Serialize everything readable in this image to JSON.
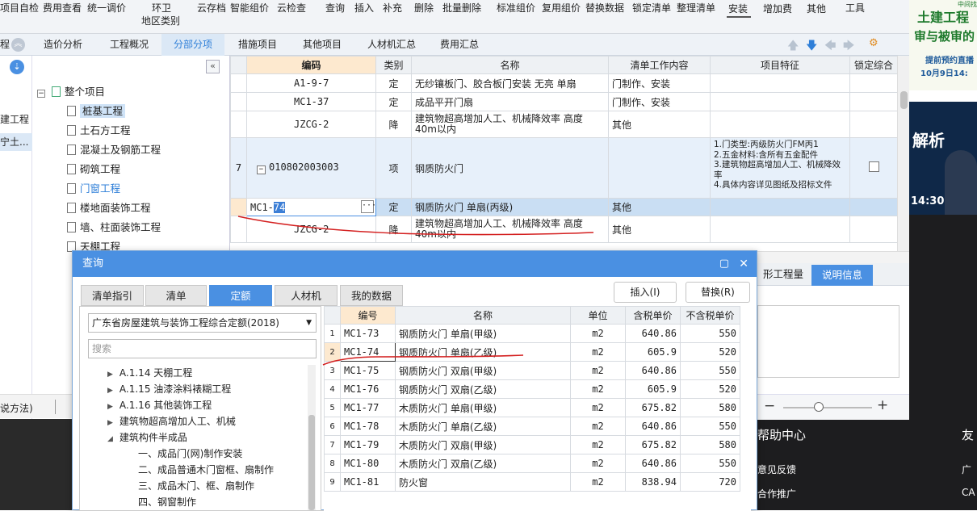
{
  "toolbar": {
    "items": [
      "项目自检",
      "费用查看",
      "统一调价",
      "环卫",
      "地区类别",
      "云存档",
      "智能组价",
      "云检查",
      "查询",
      "插入",
      "补充",
      "删除",
      "批量删除",
      "标准组价",
      "复用组价",
      "替换数据",
      "锁定清单",
      "整理清单",
      "安装",
      "增加费",
      "其他",
      "工具"
    ]
  },
  "ad": {
    "line1": "土建工程",
    "line2": "审与被审的",
    "line3": "提前预约直播",
    "line4": "10月9日14:",
    "tiny": "中间找",
    "mid1": "解析",
    "mid_time": "14:30"
  },
  "nav2": {
    "left_title": "程",
    "tabs": [
      "造价分析",
      "工程概况",
      "分部分项",
      "措施项目",
      "其他项目",
      "人材机汇总",
      "费用汇总"
    ]
  },
  "left_strip": {
    "item1": "建工程",
    "item2": "宁土..."
  },
  "tree": {
    "root": "整个项目",
    "items": [
      "桩基工程",
      "土石方工程",
      "混凝土及钢筋工程",
      "砌筑工程",
      "门窗工程",
      "楼地面装饰工程",
      "墙、柱面装饰工程",
      "天棚工程"
    ]
  },
  "grid": {
    "headers": [
      "编码",
      "类别",
      "名称",
      "清单工作内容",
      "项目特征",
      "锁定综合"
    ],
    "rows": [
      {
        "num": "",
        "code": "A1-9-7",
        "type": "定",
        "name": "无纱镶板门、胶合板门安装 无亮 单扇",
        "work": "门制作、安装",
        "feature": ""
      },
      {
        "num": "",
        "code": "MC1-37",
        "type": "定",
        "name": "成品平开门扇",
        "work": "门制作、安装",
        "feature": ""
      },
      {
        "num": "",
        "code": "JZCG-2",
        "type": "降",
        "name": "建筑物超高增加人工、机械降效率 高度 40m以内",
        "work": "其他",
        "feature": ""
      },
      {
        "num": "7",
        "code": "010802003003",
        "type": "项",
        "name": "钢质防火门",
        "work": "",
        "feature": "1.门类型:丙级防火门FM丙1\n2.五金材料:含所有五金配件\n3.建筑物超高增加人工、机械降效率\n4.具体内容详见图纸及招标文件"
      },
      {
        "num": "",
        "code_prefix": "MC1-",
        "code_sel": "74",
        "type": "定",
        "name": "钢质防火门 单扇(丙级)",
        "work": "其他",
        "feature": ""
      },
      {
        "num": "",
        "code": "JZCG-2",
        "type": "降",
        "name": "建筑物超高增加人工、机械降效率 高度 40m以内",
        "work": "其他",
        "feature": ""
      }
    ]
  },
  "dialog": {
    "title": "查询",
    "tabs": [
      "清单指引",
      "清单",
      "定额",
      "人材机",
      "我的数据"
    ],
    "insert_btn": "插入(I)",
    "replace_btn": "替换(R)",
    "library": "广东省房屋建筑与装饰工程综合定额(2018)",
    "search_placeholder": "搜索",
    "side_items": [
      "A.1.14 天棚工程",
      "A.1.15 油漆涂料裱糊工程",
      "A.1.16 其他装饰工程",
      "建筑物超高增加人工、机械",
      "建筑构件半成品",
      "一、成品门(网)制作安装",
      "二、成品普通木门窗框、扇制作",
      "三、成品木门、框、扇制作",
      "四、钢窗制作"
    ],
    "table_headers": [
      "编号",
      "名称",
      "单位",
      "含税单价",
      "不含税单价"
    ],
    "table_rows": [
      {
        "n": "1",
        "code": "MC1-73",
        "name": "钢质防火门 单扇(甲级)",
        "unit": "m2",
        "p1": "640.86",
        "p2": "550"
      },
      {
        "n": "2",
        "code": "MC1-74",
        "name": "钢质防火门 单扇(乙级)",
        "unit": "m2",
        "p1": "605.9",
        "p2": "520"
      },
      {
        "n": "3",
        "code": "MC1-75",
        "name": "钢质防火门 双扇(甲级)",
        "unit": "m2",
        "p1": "640.86",
        "p2": "550"
      },
      {
        "n": "4",
        "code": "MC1-76",
        "name": "钢质防火门 双扇(乙级)",
        "unit": "m2",
        "p1": "605.9",
        "p2": "520"
      },
      {
        "n": "5",
        "code": "MC1-77",
        "name": "木质防火门 单扇(甲级)",
        "unit": "m2",
        "p1": "675.82",
        "p2": "580"
      },
      {
        "n": "6",
        "code": "MC1-78",
        "name": "木质防火门 单扇(乙级)",
        "unit": "m2",
        "p1": "640.86",
        "p2": "550"
      },
      {
        "n": "7",
        "code": "MC1-79",
        "name": "木质防火门 双扇(甲级)",
        "unit": "m2",
        "p1": "675.82",
        "p2": "580"
      },
      {
        "n": "8",
        "code": "MC1-80",
        "name": "木质防火门 双扇(乙级)",
        "unit": "m2",
        "p1": "640.86",
        "p2": "550"
      },
      {
        "n": "9",
        "code": "MC1-81",
        "name": "防火窗",
        "unit": "m2",
        "p1": "838.94",
        "p2": "720"
      }
    ]
  },
  "right_panel": {
    "tab1": "形工程量",
    "tab2": "说明信息"
  },
  "status": {
    "left_text": "说方法)",
    "dark1": "帮助中心",
    "dark2": "友",
    "dark3": "意见反馈",
    "dark4": "广",
    "dark5": "合作推广",
    "dark6": "CA"
  },
  "colors": {
    "accent": "#4a90e2",
    "selected_row": "#cfe3f7",
    "highlight_cell": "#fde9cf"
  }
}
